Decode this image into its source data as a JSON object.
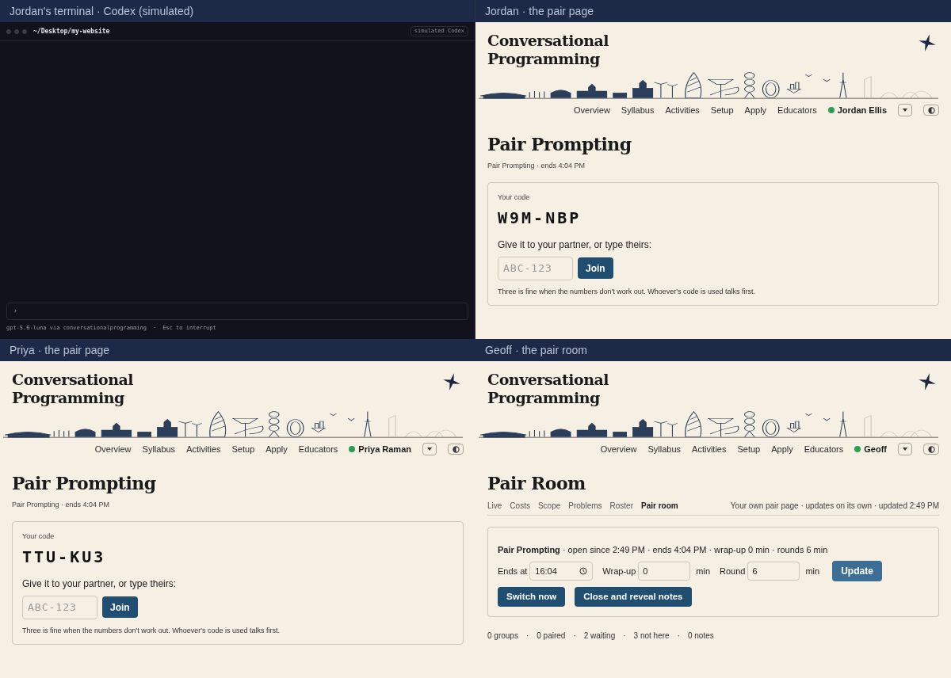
{
  "panes": [
    {
      "kind": "terminal",
      "title": "Jordan's terminal · Codex (simulated)",
      "path": "~/Desktop/my-website",
      "badge": "simulated Codex",
      "prompt": "›",
      "status": [
        "gpt-5.6-luna via conversationalprogramming",
        "·",
        "Esc to interrupt"
      ]
    },
    {
      "kind": "pair",
      "title": "Jordan · the pair page",
      "logo": "Conversational Programming",
      "nav": [
        "Overview",
        "Syllabus",
        "Activities",
        "Setup",
        "Apply",
        "Educators"
      ],
      "user": {
        "name": "Jordan Ellis",
        "online": true
      },
      "heading": "Pair Prompting",
      "subtitle": "Pair Prompting · ends 4:04 PM",
      "card": {
        "code_label": "Your code",
        "code": "W9M-NBP",
        "instruction": "Give it to your partner, or type theirs:",
        "placeholder": "ABC-123",
        "button": "Join",
        "note": "Three is fine when the numbers don't work out. Whoever's code is used talks first."
      }
    },
    {
      "kind": "pair",
      "title": "Priya · the pair page",
      "logo": "Conversational Programming",
      "nav": [
        "Overview",
        "Syllabus",
        "Activities",
        "Setup",
        "Apply",
        "Educators"
      ],
      "user": {
        "name": "Priya Raman",
        "online": true
      },
      "heading": "Pair Prompting",
      "subtitle": "Pair Prompting · ends 4:04 PM",
      "card": {
        "code_label": "Your code",
        "code": "TTU-KU3",
        "instruction": "Give it to your partner, or type theirs:",
        "placeholder": "ABC-123",
        "button": "Join",
        "note": "Three is fine when the numbers don't work out. Whoever's code is used talks first."
      }
    },
    {
      "kind": "room",
      "title": "Geoff · the pair room",
      "logo": "Conversational Programming",
      "nav": [
        "Overview",
        "Syllabus",
        "Activities",
        "Setup",
        "Apply",
        "Educators"
      ],
      "user": {
        "name": "Geoff",
        "online": true
      },
      "heading": "Pair Room",
      "tabs": [
        {
          "label": "Live",
          "selected": false
        },
        {
          "label": "Costs",
          "selected": false
        },
        {
          "label": "Scope",
          "selected": false
        },
        {
          "label": "Problems",
          "selected": false
        },
        {
          "label": "Roster",
          "selected": false
        },
        {
          "label": "Pair room",
          "selected": true
        }
      ],
      "meta": "Your own pair page · updates on its own · updated 2:49 PM",
      "card": {
        "summary": "**Pair Prompting** · open since 2:49 PM · ends 4:04 PM · wrap-up 0 min · rounds 6 min",
        "fields": [
          {
            "kind": "time",
            "label": "Ends at",
            "value": "16:04"
          },
          {
            "kind": "number",
            "label": "Wrap-up",
            "value": "0",
            "unit": "min"
          },
          {
            "kind": "number",
            "label": "Round",
            "value": "6",
            "unit": "min"
          }
        ],
        "update_button": "Update",
        "actions": [
          "Switch now",
          "Close and reveal notes"
        ]
      },
      "stats": [
        "0 groups",
        "·",
        "0 paired",
        "·",
        "2 waiting",
        "·",
        "3 not here",
        "·",
        "0 notes"
      ]
    }
  ]
}
